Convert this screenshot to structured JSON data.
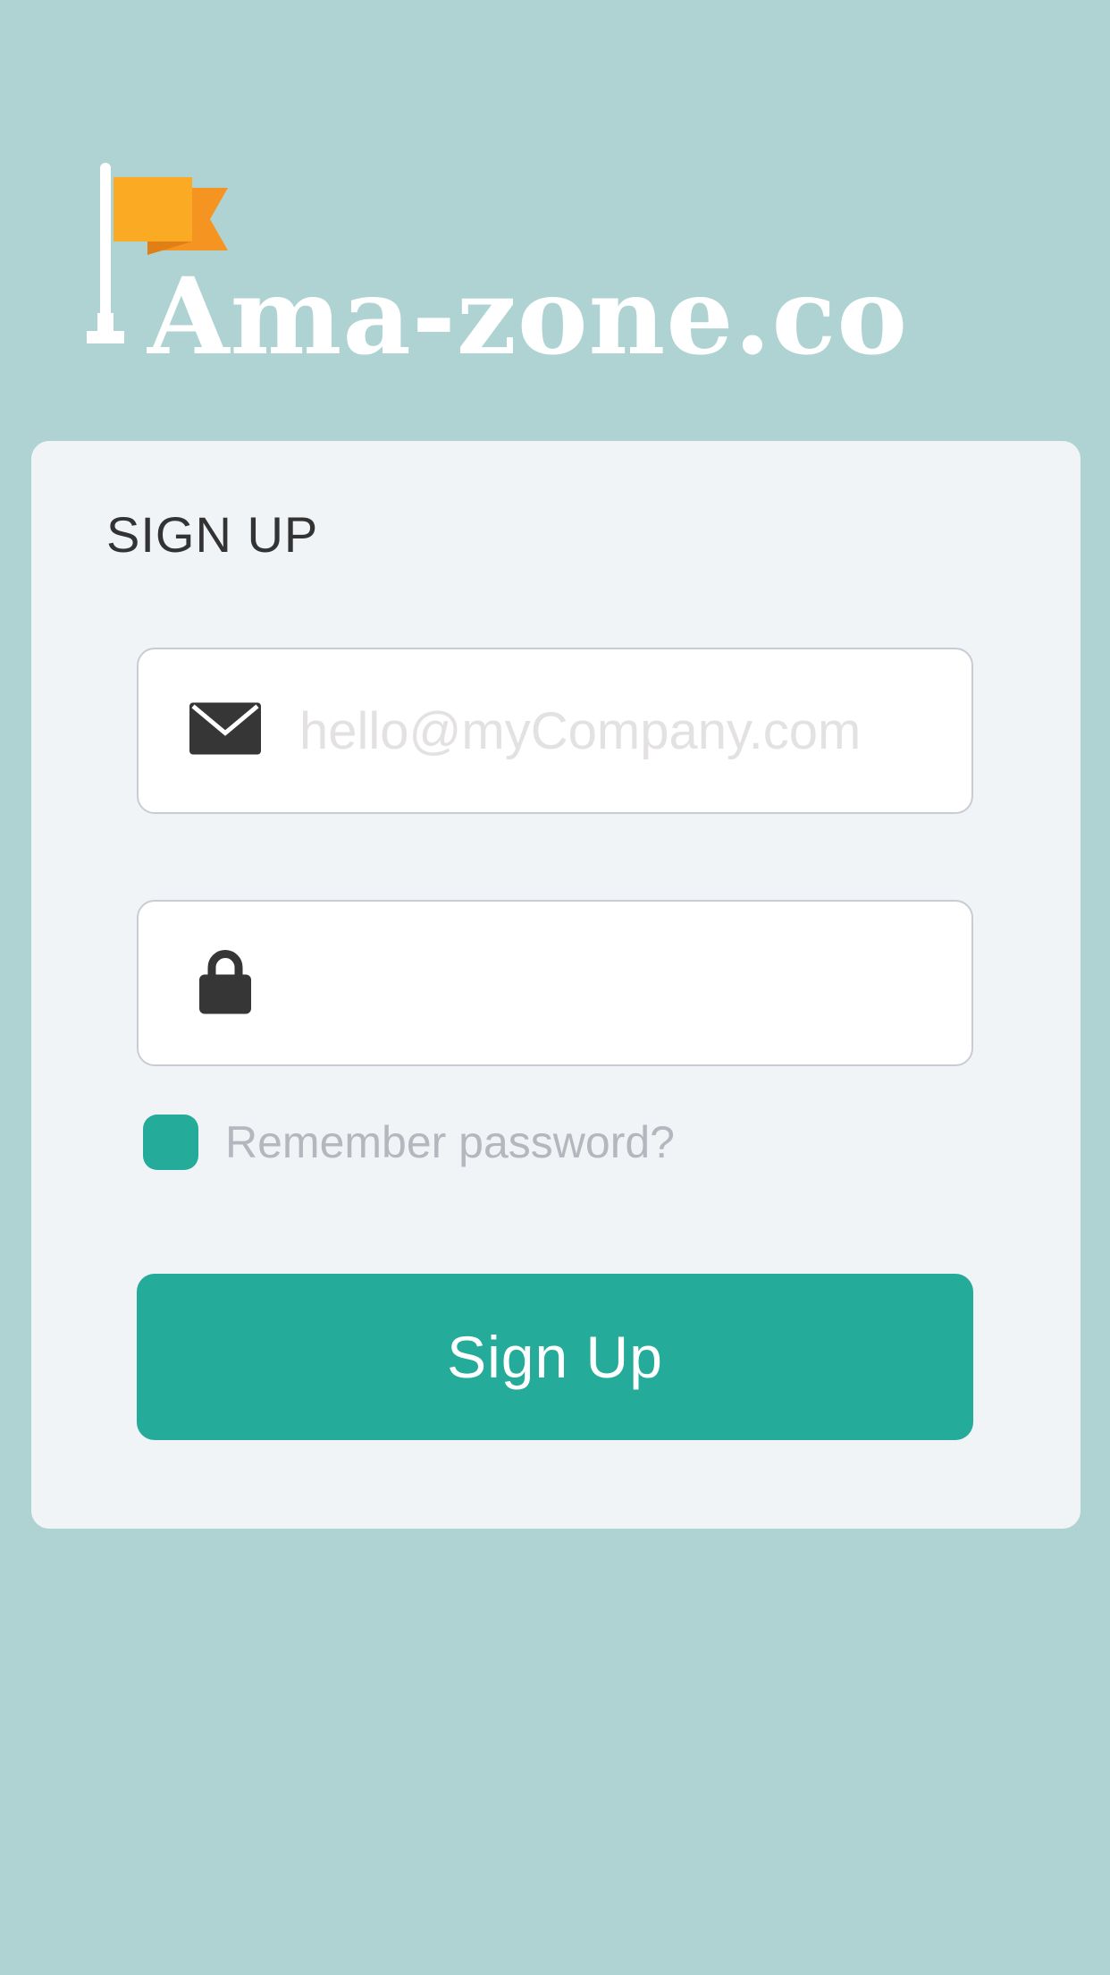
{
  "brand": {
    "name": "Ama-zone.co",
    "icon": "flag-icon",
    "flag_color": "#fbab23",
    "flag_shadow_color": "#f59420"
  },
  "form": {
    "title": "SIGN UP",
    "email": {
      "icon": "envelope-icon",
      "placeholder": "hello@myCompany.com",
      "value": ""
    },
    "password": {
      "icon": "lock-icon",
      "placeholder": "",
      "value": ""
    },
    "remember": {
      "label": "Remember password?",
      "checked": true
    },
    "submit_label": "Sign Up"
  },
  "colors": {
    "background": "#afd3d3",
    "card": "#f0f4f7",
    "accent": "#24ab9a",
    "icon": "#363636"
  }
}
